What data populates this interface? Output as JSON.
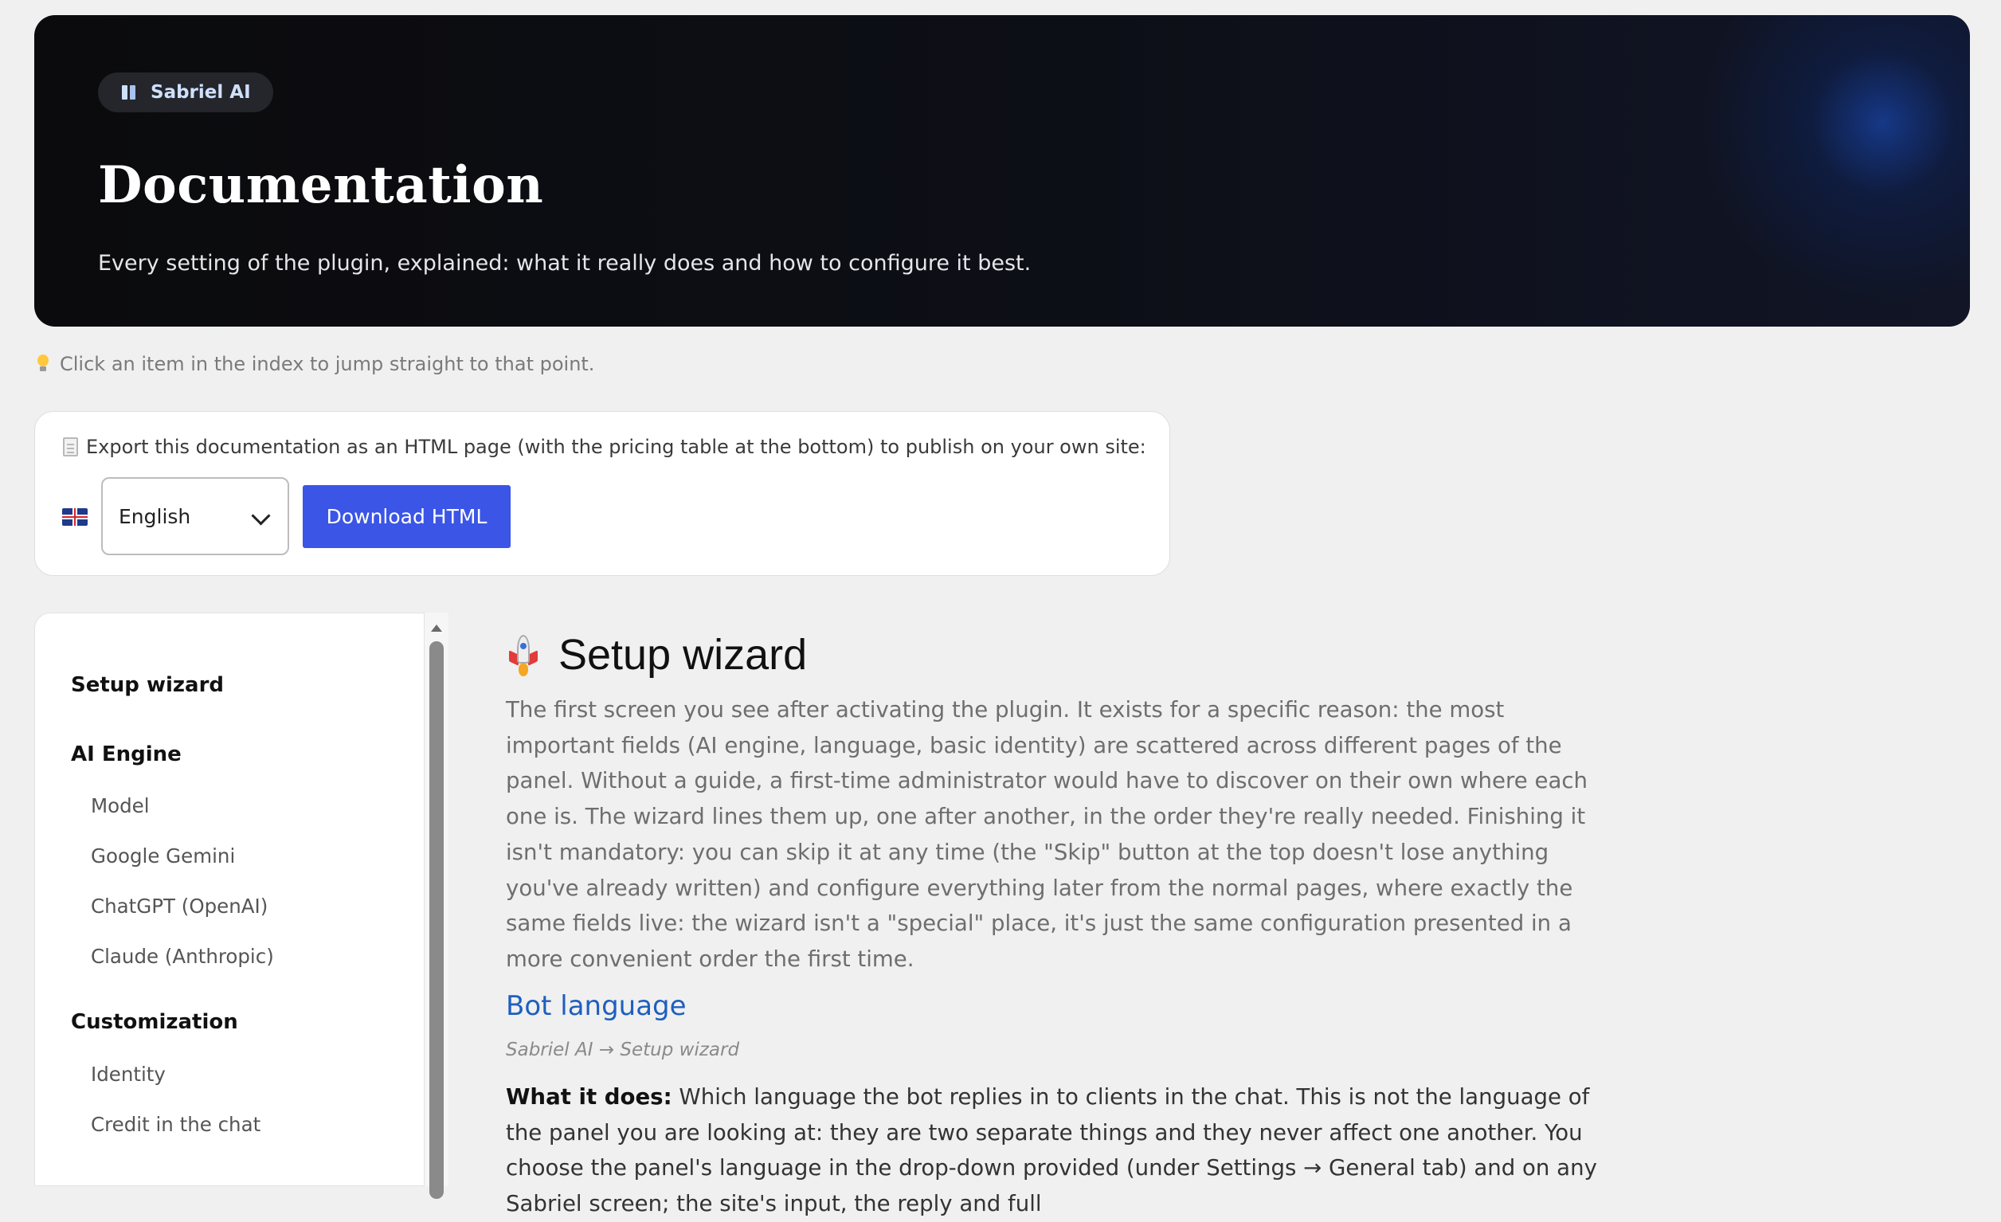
{
  "hero": {
    "badge_label": "Sabriel AI",
    "title": "Documentation",
    "subtitle": "Every setting of the plugin, explained: what it really does and how to configure it best."
  },
  "hint": "Click an item in the index to jump straight to that point.",
  "export": {
    "text": "Export this documentation as an HTML page (with the pricing table at the bottom) to publish on your own site:",
    "language_selected": "English",
    "download_label": "Download HTML"
  },
  "sidebar": {
    "groups": [
      {
        "label": "Setup wizard",
        "items": []
      },
      {
        "label": "AI Engine",
        "items": [
          "Model",
          "Google Gemini",
          "ChatGPT (OpenAI)",
          "Claude (Anthropic)"
        ]
      },
      {
        "label": "Customization",
        "items": [
          "Identity",
          "Credit in the chat"
        ]
      }
    ]
  },
  "main": {
    "section_title": "Setup wizard",
    "intro": "The first screen you see after activating the plugin. It exists for a specific reason: the most important fields (AI engine, language, basic identity) are scattered across different pages of the panel. Without a guide, a first-time administrator would have to discover on their own where each one is. The wizard lines them up, one after another, in the order they're really needed. Finishing it isn't mandatory: you can skip it at any time (the \"Skip\" button at the top doesn't lose anything you've already written) and configure everything later from the normal pages, where exactly the same fields live: the wizard isn't a \"special\" place, it's just the same configuration presented in a more convenient order the first time.",
    "sub_title": "Bot language",
    "breadcrumb": "Sabriel AI → Setup wizard",
    "desc_label": "What it does:",
    "desc_text": "Which language the bot replies in to clients in the chat. This is not the language of the panel you are looking at: they are two separate things and they never affect one another. You choose the panel's language in the drop-down provided (under Settings → General tab) and on any Sabriel screen; the site's input, the reply and full"
  }
}
